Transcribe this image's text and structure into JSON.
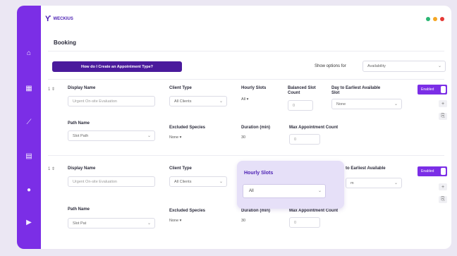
{
  "brand": {
    "name": "WECKIUS"
  },
  "colors": {
    "accent": "#7b2ee6",
    "primary_dark": "#4a1a9c",
    "dot_green": "#2bb673",
    "dot_orange": "#f5a623",
    "dot_red": "#e53935"
  },
  "sidebar": {
    "icons": [
      "home-icon",
      "calendar-icon",
      "chart-icon",
      "report-icon",
      "settings-icon",
      "video-icon"
    ]
  },
  "page": {
    "title": "Booking"
  },
  "toolbar": {
    "help_button": "How do I Create an Appointment Type?",
    "show_options_label": "Show options for",
    "show_options_value": "Availability"
  },
  "rows": [
    {
      "num": "1 ⇕",
      "display_name_label": "Display Name",
      "display_name_placeholder": "Urgent On-site Evaluation",
      "client_type_label": "Client Type",
      "client_type_value": "All Clients",
      "hourly_slots_label": "Hourly Slots",
      "hourly_slots_value": "All ▾",
      "buffer_label": "Balanced Slot Count",
      "buffer_value": "0",
      "day_label": "Day to Earliest Available Slot",
      "day_value": "None",
      "enabled_label": "Enabled",
      "path_label": "Path Name",
      "path_value": "Slot Path",
      "excluded_label": "Excluded Species",
      "excluded_value": "None ▾",
      "duration_label": "Duration (min)",
      "duration_value": "30",
      "max_label": "Max Appointment Count",
      "max_value": "0"
    },
    {
      "num": "1 ⇕",
      "display_name_label": "Display Name",
      "display_name_placeholder": "Urgent On-site Evaluation",
      "client_type_label": "Client Type",
      "client_type_value": "All Clients",
      "hourly_slots_label": "Hourly Slots",
      "hourly_slots_value": "All",
      "day_label": "to Earliest Available",
      "day_value": "m",
      "enabled_label": "Enabled",
      "path_label": "Path Name",
      "path_value": "Slot Pat",
      "excluded_label": "Excluded Species",
      "excluded_value": "None ▾",
      "duration_label": "Duration (min)",
      "duration_value": "30",
      "max_label": "Max Appointment Count",
      "max_value": "0"
    }
  ]
}
